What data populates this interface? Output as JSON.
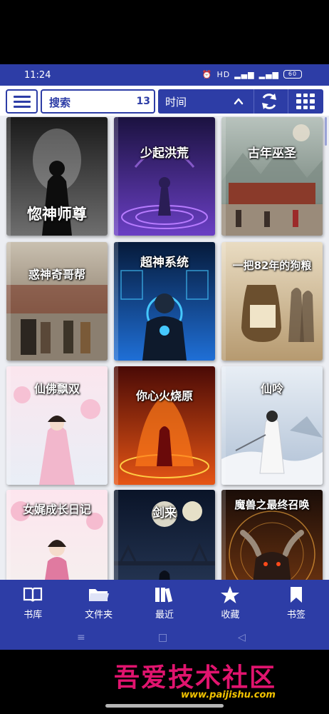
{
  "status_bar": {
    "time": "11:24",
    "icons": [
      "alarm-icon",
      "hd-icon",
      "signal-icon",
      "signal-icon",
      "battery-icon"
    ],
    "battery_text": "60"
  },
  "toolbar": {
    "menu_icon": "hamburger-menu-icon",
    "search_label": "搜索",
    "search_count": "13",
    "sort_label": "时间",
    "sort_icon": "chevron-up-icon",
    "refresh_icon": "refresh-icon",
    "view_icon": "grid-view-icon"
  },
  "books": [
    {
      "title": "惚神师尊"
    },
    {
      "title": "少起洪荒"
    },
    {
      "title": "古年巫圣"
    },
    {
      "title": "惑神奇哥帮"
    },
    {
      "title": "超神系统"
    },
    {
      "title": "一把82年的狗粮"
    },
    {
      "title": "仙佛飘双"
    },
    {
      "title": "你心火烧原"
    },
    {
      "title": "仙呤"
    },
    {
      "title": "女娓成长日记"
    },
    {
      "title": "剑来"
    },
    {
      "title": "魔兽之最终召唤"
    }
  ],
  "bottom_nav": [
    {
      "label": "书库",
      "icon": "open-book-icon"
    },
    {
      "label": "文件夹",
      "icon": "folder-icon"
    },
    {
      "label": "最近",
      "icon": "books-stack-icon"
    },
    {
      "label": "收藏",
      "icon": "star-icon"
    },
    {
      "label": "书签",
      "icon": "bookmark-icon"
    }
  ],
  "system_nav": {
    "menu": "≡",
    "home": "□",
    "back": "◁"
  },
  "watermark": {
    "text": "吾爱技术社区",
    "url": "www.paijishu.com"
  },
  "colors": {
    "primary": "#2d3da6",
    "background": "#eceef3",
    "watermark": "#e0146e"
  }
}
